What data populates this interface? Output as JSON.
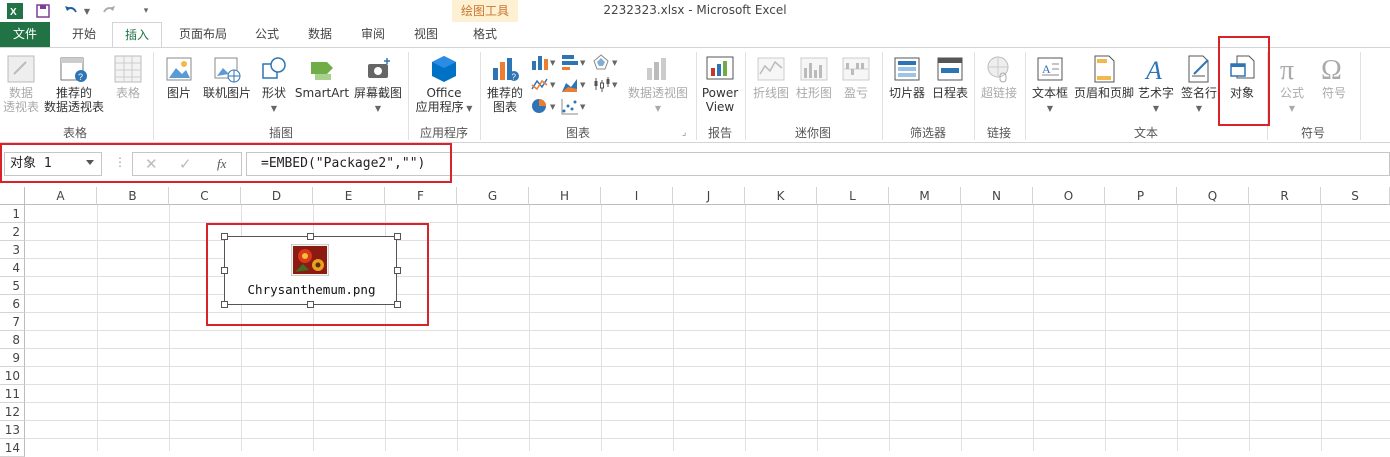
{
  "window": {
    "title": "2232323.xlsx - Microsoft Excel"
  },
  "quick_access": {
    "app_icon": "excel-icon",
    "save_icon": "save-icon",
    "undo_icon": "undo-icon",
    "redo_icon": "redo-icon",
    "customize_icon": "customize-icon"
  },
  "context_tab_label": "绘图工具",
  "tabs": [
    {
      "label": "文件"
    },
    {
      "label": "开始"
    },
    {
      "label": "插入"
    },
    {
      "label": "页面布局"
    },
    {
      "label": "公式"
    },
    {
      "label": "数据"
    },
    {
      "label": "审阅"
    },
    {
      "label": "视图"
    },
    {
      "label": "格式"
    }
  ],
  "ribbon": {
    "groups": {
      "tables": "表格",
      "illustrations": "插图",
      "apps": "应用程序",
      "charts": "图表",
      "reports": "报告",
      "sparklines": "迷你图",
      "filters": "筛选器",
      "links": "链接",
      "text": "文本",
      "symbols": "符号"
    },
    "buttons": {
      "pivot_table_1": "数据",
      "pivot_table_2": "透视表",
      "rec_pivot_1": "推荐的",
      "rec_pivot_2": "数据透视表",
      "table": "表格",
      "picture": "图片",
      "online_picture": "联机图片",
      "shapes": "形状",
      "smartart": "SmartArt",
      "screenshot": "屏幕截图",
      "office_apps_1": "Office",
      "office_apps_2": "应用程序",
      "rec_charts_1": "推荐的",
      "rec_charts_2": "图表",
      "pivot_chart": "数据透视图",
      "power_view_1": "Power",
      "power_view_2": "View",
      "line_spark": "折线图",
      "column_spark": "柱形图",
      "winloss_spark": "盈亏",
      "slicer": "切片器",
      "timeline": "日程表",
      "hyperlink": "超链接",
      "textbox": "文本框",
      "header_footer": "页眉和页脚",
      "wordart": "艺术字",
      "signature": "签名行",
      "object": "对象",
      "equation": "公式",
      "symbol": "符号"
    }
  },
  "formula_bar": {
    "name_box": "对象 1",
    "formula": "=EMBED(\"Package2\",\"\")"
  },
  "columns": [
    "A",
    "B",
    "C",
    "D",
    "E",
    "F",
    "G",
    "H",
    "I",
    "J",
    "K",
    "L",
    "M",
    "N",
    "O",
    "P",
    "Q",
    "R",
    "S"
  ],
  "rows": [
    "1",
    "2",
    "3",
    "4",
    "5",
    "6",
    "7",
    "8",
    "9",
    "10",
    "11",
    "12",
    "13",
    "14"
  ],
  "embedded_object": {
    "filename": "Chrysanthemum.png",
    "icon": "image-file-icon"
  },
  "colors": {
    "accent": "#217346",
    "highlight": "#d8232a",
    "context_tab": "#fdf0d3"
  }
}
